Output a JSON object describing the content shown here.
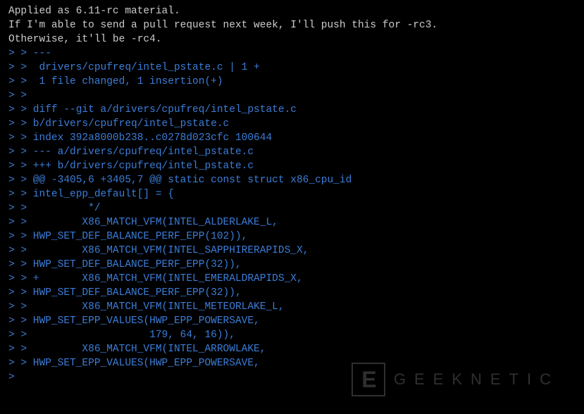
{
  "message": {
    "line1": "Applied as 6.11-rc material.",
    "line2": "",
    "line3": "If I'm able to send a pull request next week, I'll push this for -rc3.",
    "line4": "Otherwise, it'll be -rc4.",
    "line5": ""
  },
  "quoted": [
    "> > ---",
    "> >  drivers/cpufreq/intel_pstate.c | 1 +",
    "> >  1 file changed, 1 insertion(+)",
    "> >",
    "> > diff --git a/drivers/cpufreq/intel_pstate.c",
    "> > b/drivers/cpufreq/intel_pstate.c",
    "> > index 392a8000b238..c0278d023cfc 100644",
    "> > --- a/drivers/cpufreq/intel_pstate.c",
    "> > +++ b/drivers/cpufreq/intel_pstate.c",
    "> > @@ -3405,6 +3405,7 @@ static const struct x86_cpu_id",
    "> > intel_epp_default[] = {",
    "> >          */",
    "> >         X86_MATCH_VFM(INTEL_ALDERLAKE_L,",
    "> > HWP_SET_DEF_BALANCE_PERF_EPP(102)),",
    "> >         X86_MATCH_VFM(INTEL_SAPPHIRERAPIDS_X,",
    "> > HWP_SET_DEF_BALANCE_PERF_EPP(32)),",
    "> > +       X86_MATCH_VFM(INTEL_EMERALDRAPIDS_X,",
    "> > HWP_SET_DEF_BALANCE_PERF_EPP(32)),",
    "> >         X86_MATCH_VFM(INTEL_METEORLAKE_L,",
    "> > HWP_SET_EPP_VALUES(HWP_EPP_POWERSAVE,",
    "> >                    179, 64, 16)),",
    "> >         X86_MATCH_VFM(INTEL_ARROWLAKE,",
    "> > HWP_SET_EPP_VALUES(HWP_EPP_POWERSAVE,",
    ">"
  ],
  "watermark": {
    "logo_letter": "E",
    "text": "GEEKNETIC"
  }
}
